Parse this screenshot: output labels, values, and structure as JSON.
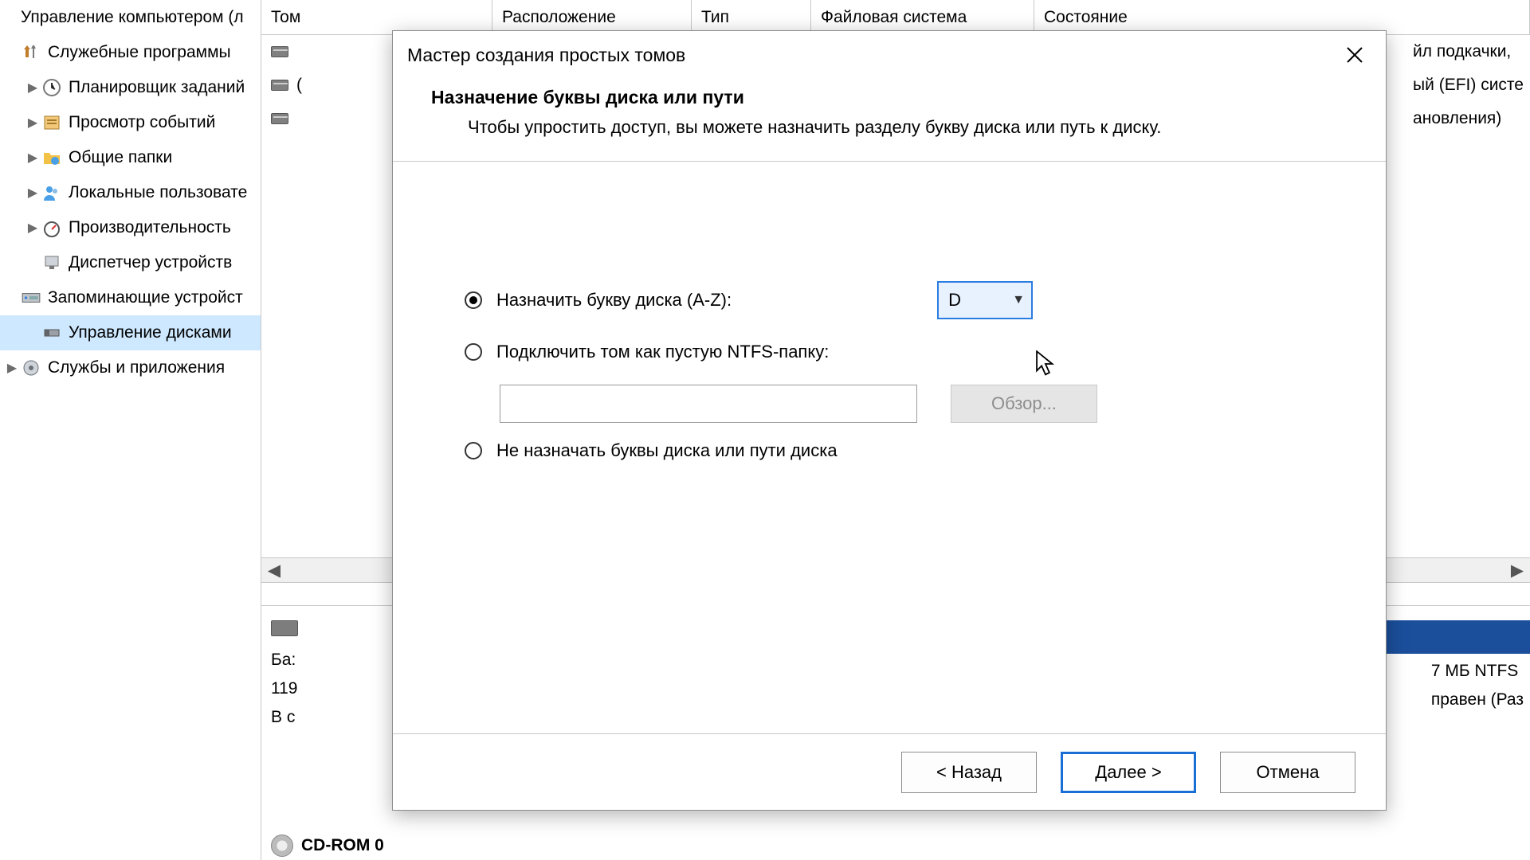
{
  "tree": {
    "root": "Управление компьютером (л",
    "utilities": "Служебные программы",
    "scheduler": "Планировщик заданий",
    "events": "Просмотр событий",
    "shared": "Общие папки",
    "users": "Локальные пользовате",
    "perf": "Производительность",
    "devmgr": "Диспетчер устройств",
    "storage": "Запоминающие устройст",
    "diskmgmt": "Управление дисками",
    "services": "Службы и приложения"
  },
  "columns": {
    "c0": "Том",
    "c1": "Расположение",
    "c2": "Тип",
    "c3": "Файловая система",
    "c4": "Состояние"
  },
  "rows_right": {
    "r0": "йл подкачки,",
    "r1": "ый (EFI) систе",
    "r2": "ановления)"
  },
  "disk0": {
    "l1": "Ба:",
    "l2": "119",
    "l3": "В с"
  },
  "part": {
    "l1": "7 МБ NTFS",
    "l2": "правен (Раз"
  },
  "cdrom": "CD-ROM 0",
  "dialog": {
    "title": "Мастер создания простых томов",
    "heading": "Назначение буквы диска или пути",
    "desc": "Чтобы упростить доступ, вы можете назначить разделу букву диска или путь к диску.",
    "opt_assign": "Назначить букву диска (A-Z):",
    "opt_mount": "Подключить том как пустую NTFS-папку:",
    "opt_none": "Не назначать буквы диска или пути диска",
    "letter": "D",
    "browse": "Обзор...",
    "back": "< Назад",
    "next": "Далее >",
    "cancel": "Отмена"
  }
}
